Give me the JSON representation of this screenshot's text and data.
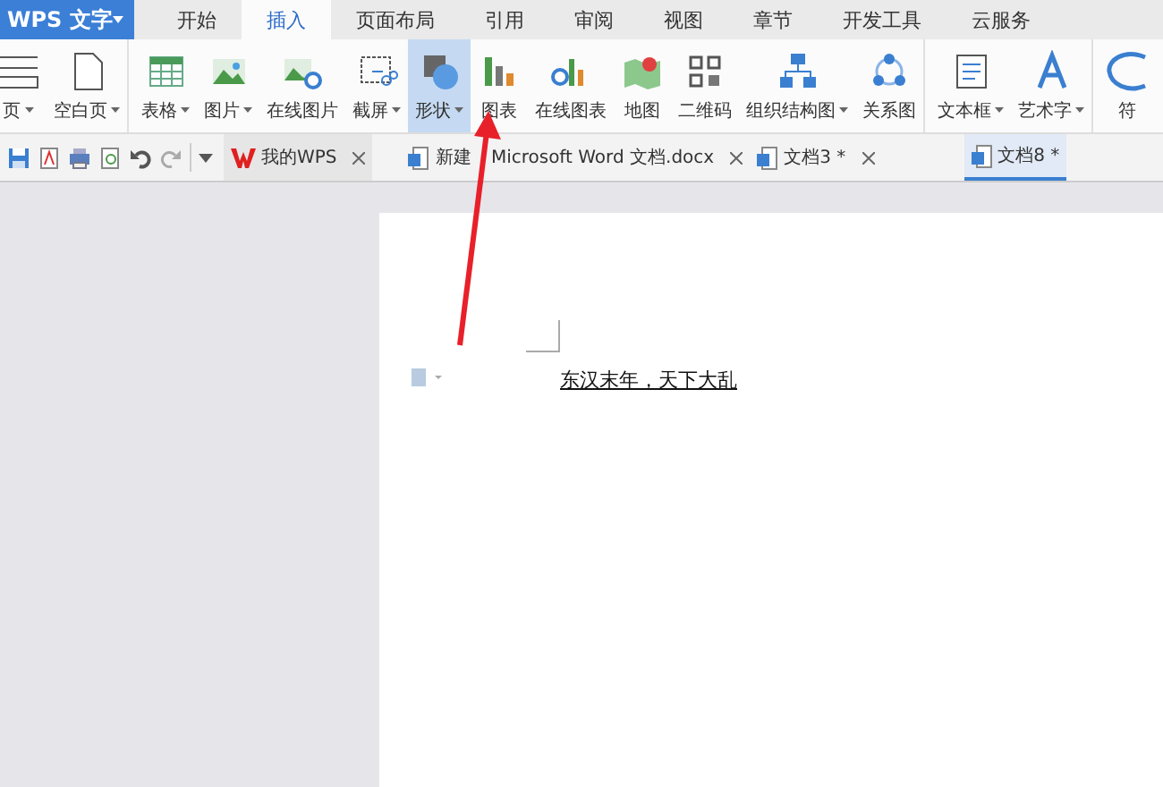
{
  "app_button": {
    "label": "WPS 文字"
  },
  "tabs": [
    {
      "label": "开始",
      "selected": false
    },
    {
      "label": "插入",
      "selected": true
    },
    {
      "label": "页面布局",
      "selected": false
    },
    {
      "label": "引用",
      "selected": false
    },
    {
      "label": "审阅",
      "selected": false
    },
    {
      "label": "视图",
      "selected": false
    },
    {
      "label": "章节",
      "selected": false
    },
    {
      "label": "开发工具",
      "selected": false
    },
    {
      "label": "云服务",
      "selected": false
    }
  ],
  "ribbon": [
    {
      "kind": "page",
      "label": "页",
      "dropdown": true,
      "selected": false,
      "group_end": false
    },
    {
      "kind": "blank-page",
      "label": "空白页",
      "dropdown": true,
      "selected": false,
      "group_end": true
    },
    {
      "kind": "table",
      "label": "表格",
      "dropdown": true,
      "selected": false,
      "group_end": false
    },
    {
      "kind": "image",
      "label": "图片",
      "dropdown": true,
      "selected": false,
      "group_end": false
    },
    {
      "kind": "online-image",
      "label": "在线图片",
      "dropdown": false,
      "selected": false,
      "group_end": false
    },
    {
      "kind": "screenshot",
      "label": "截屏",
      "dropdown": true,
      "selected": false,
      "group_end": false
    },
    {
      "kind": "shape",
      "label": "形状",
      "dropdown": true,
      "selected": true,
      "group_end": false
    },
    {
      "kind": "chart",
      "label": "图表",
      "dropdown": false,
      "selected": false,
      "group_end": false
    },
    {
      "kind": "online-chart",
      "label": "在线图表",
      "dropdown": false,
      "selected": false,
      "group_end": false
    },
    {
      "kind": "map",
      "label": "地图",
      "dropdown": false,
      "selected": false,
      "group_end": false
    },
    {
      "kind": "qrcode",
      "label": "二维码",
      "dropdown": false,
      "selected": false,
      "group_end": false
    },
    {
      "kind": "org-chart",
      "label": "组织结构图",
      "dropdown": true,
      "selected": false,
      "group_end": false
    },
    {
      "kind": "relation",
      "label": "关系图",
      "dropdown": false,
      "selected": false,
      "group_end": true
    },
    {
      "kind": "textbox",
      "label": "文本框",
      "dropdown": true,
      "selected": false,
      "group_end": false
    },
    {
      "kind": "wordart",
      "label": "艺术字",
      "dropdown": true,
      "selected": false,
      "group_end": true
    },
    {
      "kind": "symbol",
      "label": "符",
      "dropdown": false,
      "selected": false,
      "group_end": false
    }
  ],
  "doc_tabs": [
    {
      "kind": "home",
      "label": "我的WPS",
      "selected": false
    },
    {
      "kind": "doc",
      "label": "新建 Microsoft Word 文档.docx",
      "selected": false
    },
    {
      "kind": "doc",
      "label": "文档3 *",
      "selected": false
    },
    {
      "kind": "doc",
      "label": "文档8 *",
      "selected": true
    }
  ],
  "document": {
    "text": "东汉末年，天下大乱"
  }
}
